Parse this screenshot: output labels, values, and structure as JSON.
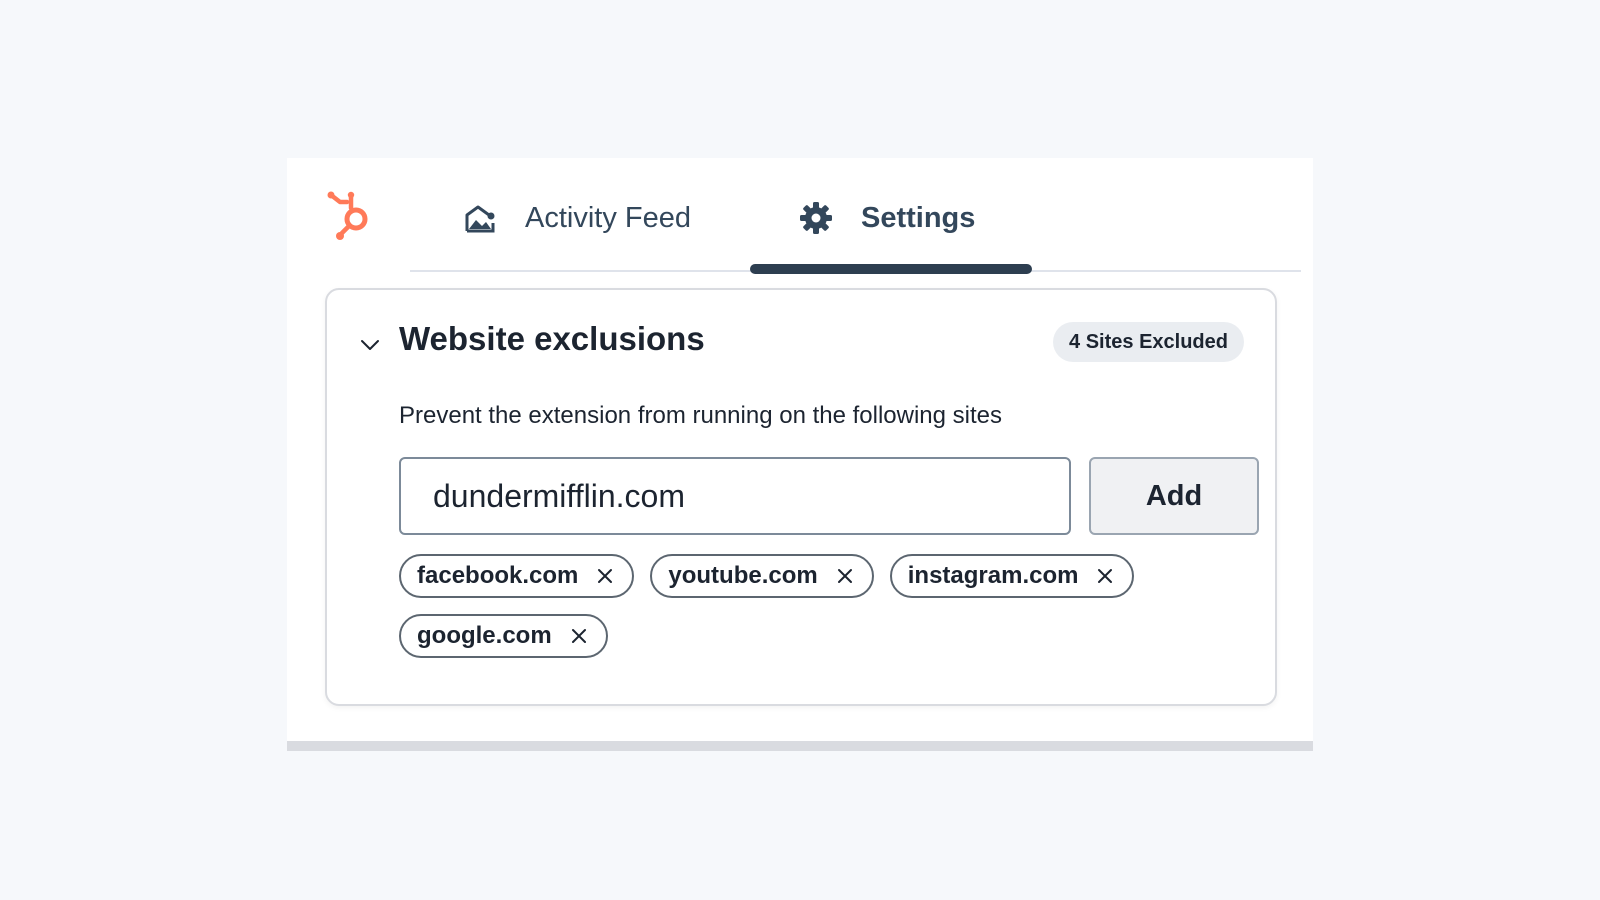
{
  "nav": {
    "tabs": [
      {
        "label": "Activity Feed",
        "icon": "activity-feed-icon",
        "active": false
      },
      {
        "label": "Settings",
        "icon": "gear-icon",
        "active": true
      }
    ]
  },
  "colors": {
    "brand": "#ff7a59",
    "active_indicator": "#2d3e50",
    "text": "#33475b"
  },
  "section": {
    "title": "Website exclusions",
    "badge": "4 Sites Excluded",
    "expanded": true,
    "description": "Prevent the extension from running on the following sites",
    "input_value": "dundermifflin.com",
    "add_label": "Add",
    "excluded_sites": [
      {
        "label": "facebook.com"
      },
      {
        "label": "youtube.com"
      },
      {
        "label": "instagram.com"
      },
      {
        "label": "google.com"
      }
    ]
  }
}
